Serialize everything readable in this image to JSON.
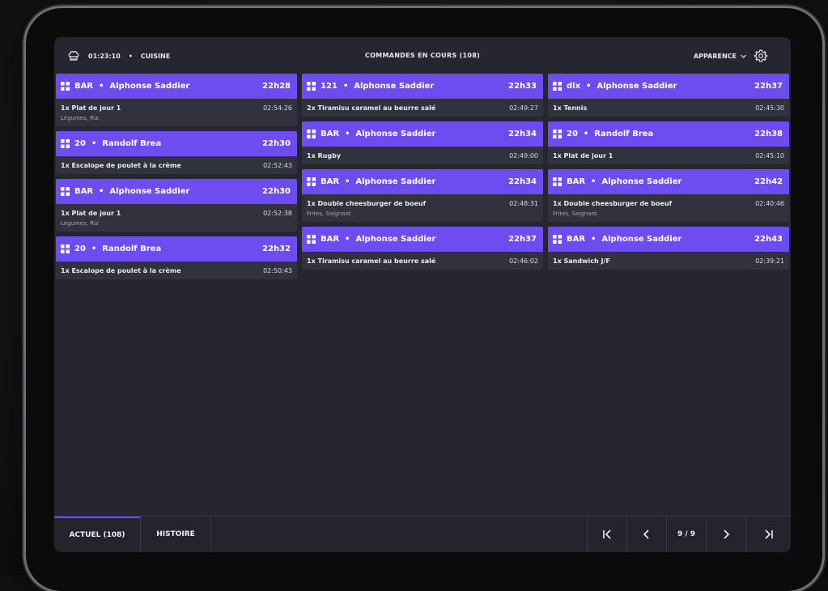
{
  "header": {
    "clock": "01:23:10",
    "station": "CUISINE",
    "title": "COMMANDES EN COURS (108)",
    "appearance_label": "APPARENCE"
  },
  "columns": [
    [
      {
        "location": "BAR",
        "customer": "Alphonse Saddier",
        "time": "22h28",
        "items": [
          {
            "text": "1x Plat de jour 1",
            "elapsed": "02:54:26",
            "note": "Légumes, Riz"
          }
        ]
      },
      {
        "location": "20",
        "customer": "Randolf Brea",
        "time": "22h30",
        "items": [
          {
            "text": "1x Escalope de poulet à la crème",
            "elapsed": "02:52:43",
            "note": ""
          }
        ]
      },
      {
        "location": "BAR",
        "customer": "Alphonse Saddier",
        "time": "22h30",
        "items": [
          {
            "text": "1x Plat de jour 1",
            "elapsed": "02:52:38",
            "note": "Légumes, Riz"
          }
        ]
      },
      {
        "location": "20",
        "customer": "Randolf Brea",
        "time": "22h32",
        "items": [
          {
            "text": "1x Escalope de poulet à la crème",
            "elapsed": "02:50:43",
            "note": ""
          }
        ]
      }
    ],
    [
      {
        "location": "121",
        "customer": "Alphonse Saddier",
        "time": "22h33",
        "items": [
          {
            "text": "2x Tiramisu caramel au beurre salé",
            "elapsed": "02:49:27",
            "note": ""
          }
        ]
      },
      {
        "location": "BAR",
        "customer": "Alphonse Saddier",
        "time": "22h34",
        "items": [
          {
            "text": "1x Rugby",
            "elapsed": "02:49:00",
            "note": ""
          }
        ]
      },
      {
        "location": "BAR",
        "customer": "Alphonse Saddier",
        "time": "22h34",
        "items": [
          {
            "text": "1x Double cheesburger de boeuf",
            "elapsed": "02:48:31",
            "note": "Frites, Saignant"
          }
        ]
      },
      {
        "location": "BAR",
        "customer": "Alphonse Saddier",
        "time": "22h37",
        "items": [
          {
            "text": "1x Tiramisu caramel au beurre salé",
            "elapsed": "02:46:02",
            "note": ""
          }
        ]
      }
    ],
    [
      {
        "location": "dix",
        "customer": "Alphonse Saddier",
        "time": "22h37",
        "items": [
          {
            "text": "1x Tennis",
            "elapsed": "02:45:30",
            "note": ""
          }
        ]
      },
      {
        "location": "20",
        "customer": "Randolf Brea",
        "time": "22h38",
        "items": [
          {
            "text": "1x Plat de jour 1",
            "elapsed": "02:45:10",
            "note": ""
          }
        ]
      },
      {
        "location": "BAR",
        "customer": "Alphonse Saddier",
        "time": "22h42",
        "items": [
          {
            "text": "1x Double cheesburger de boeuf",
            "elapsed": "02:40:46",
            "note": "Frites, Saignant"
          }
        ]
      },
      {
        "location": "BAR",
        "customer": "Alphonse Saddier",
        "time": "22h43",
        "items": [
          {
            "text": "1x Sandwich J/F",
            "elapsed": "02:39:21",
            "note": ""
          }
        ]
      }
    ]
  ],
  "footer": {
    "tab_current": "ACTUEL (108)",
    "tab_history": "HISTOIRE",
    "page_indicator": "9 / 9"
  },
  "colors": {
    "accent": "#6d4cf0",
    "background": "#25262f",
    "card": "#31323e"
  },
  "icons": [
    "chef-hat-icon",
    "settings-gear-icon",
    "chevron-down-icon",
    "grid-icon",
    "first-page-icon",
    "previous-page-icon",
    "next-page-icon",
    "last-page-icon"
  ]
}
